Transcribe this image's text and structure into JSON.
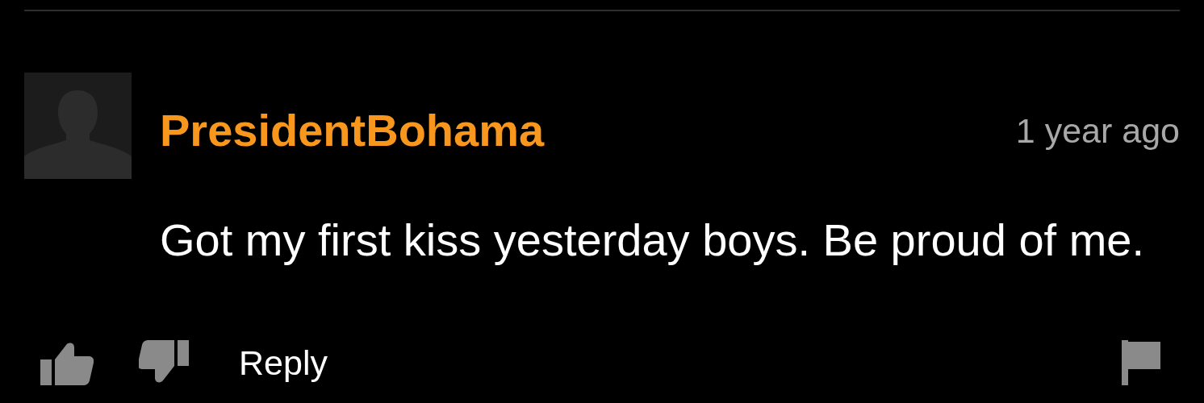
{
  "comment": {
    "username": "PresidentBohama",
    "time": "1 year ago",
    "text": "Got my first kiss yesterday boys. Be proud of me.",
    "reply_label": "Reply"
  }
}
